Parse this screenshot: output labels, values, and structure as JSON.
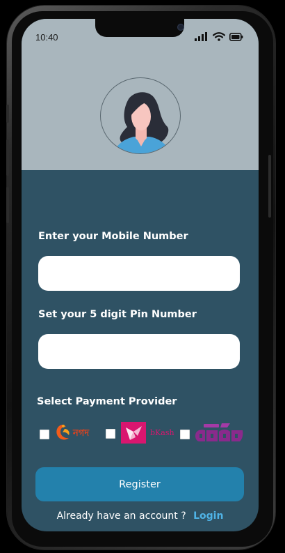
{
  "status_bar": {
    "time": "10:40",
    "icons": [
      "cellular-signal-icon",
      "wifi-icon",
      "battery-icon"
    ]
  },
  "profile": {
    "avatar_icon": "woman-avatar-icon"
  },
  "form": {
    "mobile_label": "Enter your Mobile Number",
    "mobile_value": "",
    "pin_label": "Set your 5 digit Pin Number",
    "pin_value": "",
    "provider_label": "Select Payment Provider",
    "providers": [
      {
        "name": "nagad",
        "logo_text": "নগদ",
        "checked": false,
        "color": "#e8421b"
      },
      {
        "name": "bkash",
        "logo_text": "bKash",
        "checked": false,
        "color": "#d9166f"
      },
      {
        "name": "rocket",
        "logo_text": "রকেট",
        "checked": false,
        "color": "#8a2a8c"
      }
    ],
    "register_label": "Register",
    "footer_text": "Already have an account ?",
    "login_label": "Login"
  },
  "colors": {
    "header_bg": "#a9b6bd",
    "body_bg": "#2f5264",
    "button_bg": "#2381ac",
    "link": "#4fb3e6"
  }
}
